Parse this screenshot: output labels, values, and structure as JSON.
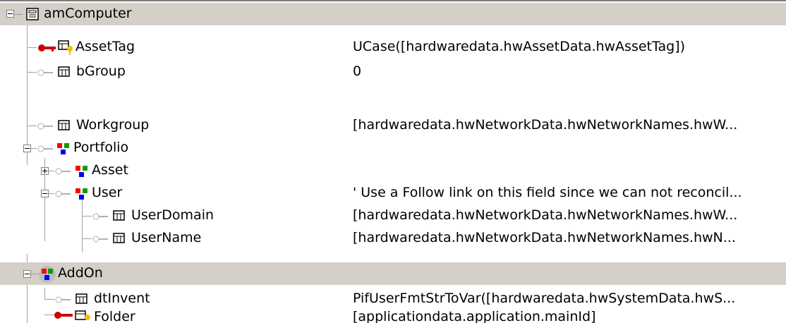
{
  "tree": {
    "root": {
      "label": "amComputer"
    },
    "rows": [
      {
        "label": "AssetTag",
        "value": "UCase([hardwaredata.hwAssetData.hwAssetTag])"
      },
      {
        "label": "bGroup",
        "value": "0"
      },
      {
        "label": "Workgroup",
        "value": "[hardwaredata.hwNetworkData.hwNetworkNames.hwW..."
      },
      {
        "label": "Portfolio",
        "value": ""
      },
      {
        "label": "Asset",
        "value": ""
      },
      {
        "label": "User",
        "value": "' Use a Follow link on this field since we can not reconcil..."
      },
      {
        "label": "UserDomain",
        "value": "[hardwaredata.hwNetworkData.hwNetworkNames.hwW..."
      },
      {
        "label": "UserName",
        "value": "[hardwaredata.hwNetworkData.hwNetworkNames.hwN..."
      },
      {
        "label": "AddOn",
        "value": ""
      },
      {
        "label": "dtInvent",
        "value": "PifUserFmtStrToVar([hardwaredata.hwSystemData.hwS..."
      },
      {
        "label": "Folder",
        "value": "[applicationdata.application.mainId]"
      }
    ]
  },
  "colors": {
    "selected_row": "#d4d0c8",
    "key_red": "#cc0000",
    "key_yellow": "#f0c000",
    "link_red": "#ff0000",
    "link_green": "#00a000",
    "link_blue": "#0000ff"
  }
}
